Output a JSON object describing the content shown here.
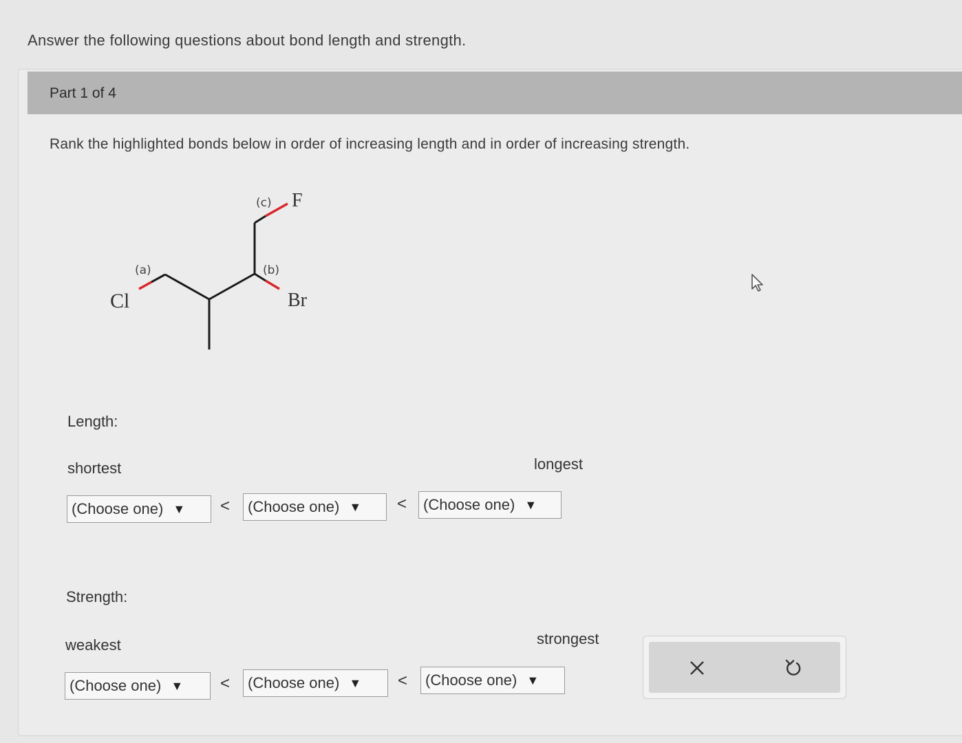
{
  "question": "Answer the following questions about bond length and strength.",
  "part": {
    "title": "Part 1 of 4"
  },
  "instruction": "Rank the highlighted bonds below in order of increasing length and in order of increasing strength.",
  "molecule": {
    "labels": {
      "a": "(a)",
      "b": "(b)",
      "c": "(c)"
    },
    "atoms": {
      "cl": "Cl",
      "br": "Br",
      "f": "F"
    },
    "colors": {
      "bond": "#1a1a1a",
      "highlight": "#d9262b"
    }
  },
  "length": {
    "label": "Length:",
    "low_label": "shortest",
    "high_label": "longest",
    "dropdowns": [
      "(Choose one)",
      "(Choose one)",
      "(Choose one)"
    ],
    "separator": "<"
  },
  "strength": {
    "label": "Strength:",
    "low_label": "weakest",
    "high_label": "strongest",
    "dropdowns": [
      "(Choose one)",
      "(Choose one)",
      "(Choose one)"
    ],
    "separator": "<"
  },
  "actions": {
    "clear_icon": "close-icon",
    "undo_icon": "undo-icon"
  }
}
